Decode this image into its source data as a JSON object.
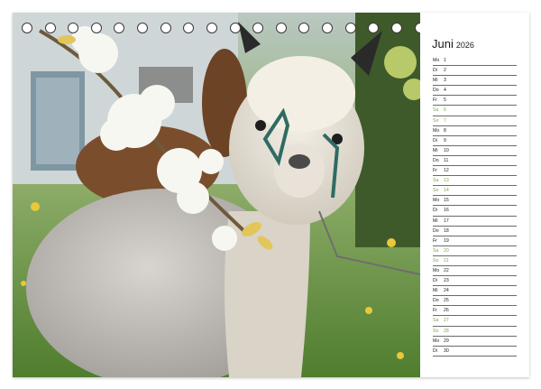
{
  "calendar": {
    "month": "Juni",
    "year": "2026",
    "weekend_color": "#7aa84a",
    "days": [
      {
        "dow": "Mo",
        "day": "1",
        "weekend": false
      },
      {
        "dow": "Di",
        "day": "2",
        "weekend": false
      },
      {
        "dow": "Mi",
        "day": "3",
        "weekend": false
      },
      {
        "dow": "Do",
        "day": "4",
        "weekend": false
      },
      {
        "dow": "Fr",
        "day": "5",
        "weekend": false
      },
      {
        "dow": "Sa",
        "day": "6",
        "weekend": true
      },
      {
        "dow": "So",
        "day": "7",
        "weekend": true
      },
      {
        "dow": "Mo",
        "day": "8",
        "weekend": false
      },
      {
        "dow": "Di",
        "day": "9",
        "weekend": false
      },
      {
        "dow": "Mi",
        "day": "10",
        "weekend": false
      },
      {
        "dow": "Do",
        "day": "11",
        "weekend": false
      },
      {
        "dow": "Fr",
        "day": "12",
        "weekend": false
      },
      {
        "dow": "Sa",
        "day": "13",
        "weekend": true
      },
      {
        "dow": "So",
        "day": "14",
        "weekend": true
      },
      {
        "dow": "Mo",
        "day": "15",
        "weekend": false
      },
      {
        "dow": "Di",
        "day": "16",
        "weekend": false
      },
      {
        "dow": "Mi",
        "day": "17",
        "weekend": false
      },
      {
        "dow": "Do",
        "day": "18",
        "weekend": false
      },
      {
        "dow": "Fr",
        "day": "19",
        "weekend": false
      },
      {
        "dow": "Sa",
        "day": "20",
        "weekend": true
      },
      {
        "dow": "So",
        "day": "21",
        "weekend": true
      },
      {
        "dow": "Mo",
        "day": "22",
        "weekend": false
      },
      {
        "dow": "Di",
        "day": "23",
        "weekend": false
      },
      {
        "dow": "Mi",
        "day": "24",
        "weekend": false
      },
      {
        "dow": "Do",
        "day": "25",
        "weekend": false
      },
      {
        "dow": "Fr",
        "day": "26",
        "weekend": false
      },
      {
        "dow": "Sa",
        "day": "27",
        "weekend": true
      },
      {
        "dow": "So",
        "day": "28",
        "weekend": true
      },
      {
        "dow": "Mo",
        "day": "29",
        "weekend": false
      },
      {
        "dow": "Di",
        "day": "30",
        "weekend": false
      }
    ]
  },
  "binding": {
    "ring_count": 22,
    "ring_color": "#3a3a3a"
  },
  "photo": {
    "colors": {
      "grass": "#5f8f3a",
      "alpaca_fleece": "#c9c6c2",
      "halter": "#2f6b63",
      "blossom": "#f7f7f2"
    }
  }
}
